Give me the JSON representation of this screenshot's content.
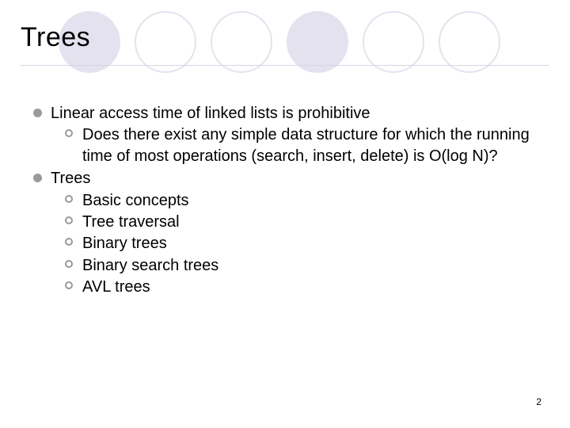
{
  "title": "Trees",
  "bullets": {
    "b0": {
      "text": "Linear access time of linked lists is prohibitive",
      "sub": {
        "s0": "Does there exist any simple data structure for which the running time of most operations (search, insert, delete) is O(log N)?"
      }
    },
    "b1": {
      "text": "Trees",
      "sub": {
        "s0": "Basic concepts",
        "s1": "Tree traversal",
        "s2": "Binary trees",
        "s3": "Binary search trees",
        "s4": "AVL trees"
      }
    }
  },
  "page_number": "2"
}
